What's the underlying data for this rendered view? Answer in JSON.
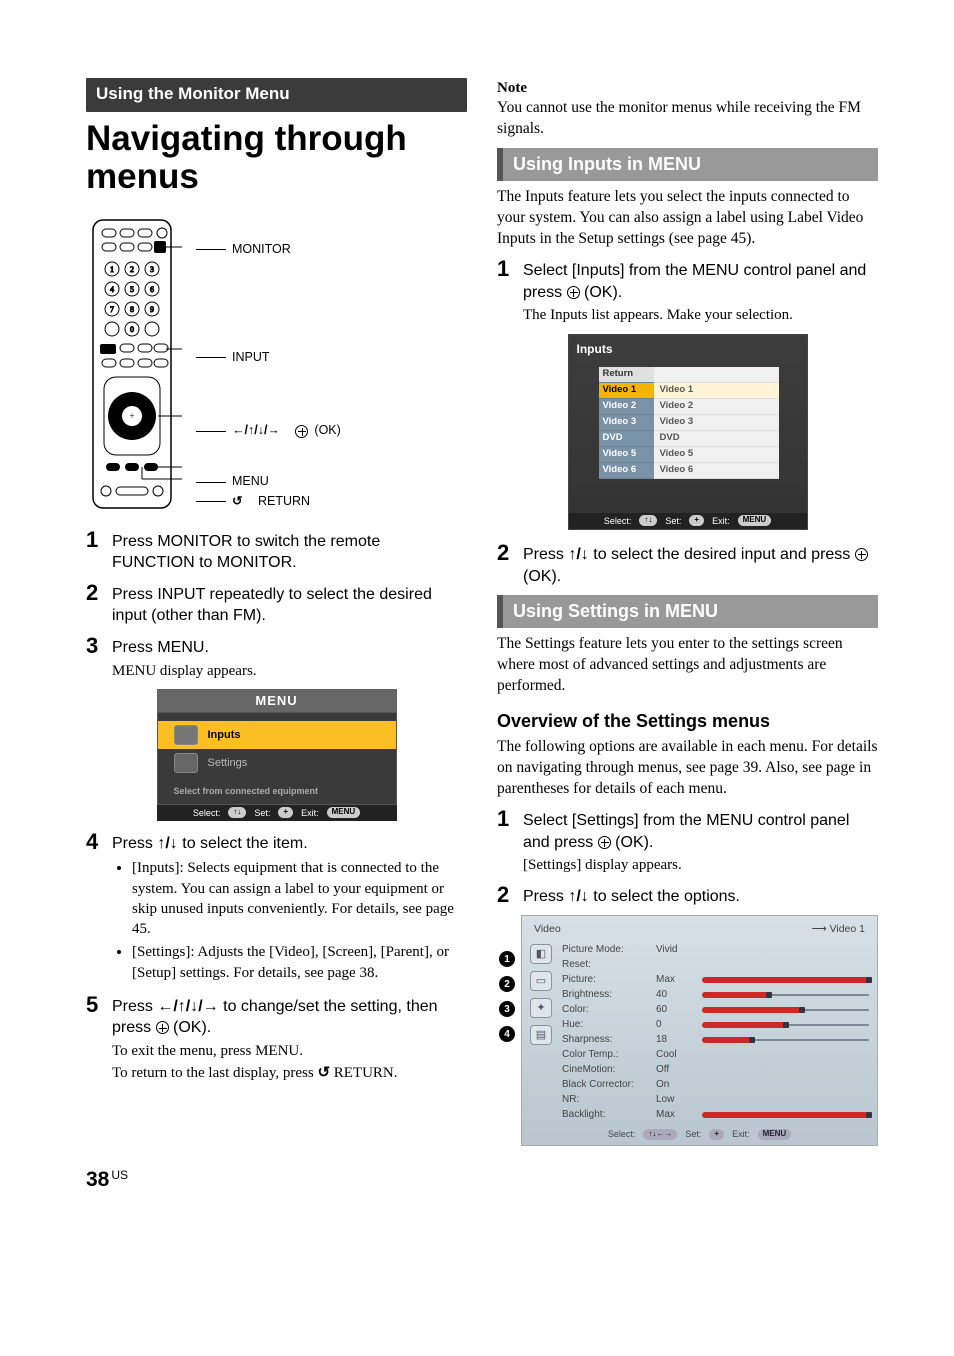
{
  "page": {
    "number": "38",
    "suffix": "US"
  },
  "left": {
    "section_bar": "Using the Monitor Menu",
    "title": "Navigating through menus",
    "remote_labels": {
      "monitor": "MONITOR",
      "input": "INPUT",
      "arrows_ok": "B/V/v/b     (OK)",
      "menu": "MENU",
      "return": "RETURN"
    },
    "steps": {
      "s1": "Press MONITOR to switch the remote FUNCTION to MONITOR.",
      "s2": "Press INPUT repeatedly to select the desired input (other than FM).",
      "s3": "Press MENU.",
      "s3b": "MENU display appears.",
      "s4": "Press V/v to select the item.",
      "s4_bullets": [
        "[Inputs]: Selects equipment that is connected to the system. You can assign a label to your equipment or skip unused inputs conveniently. For details, see page 45.",
        "[Settings]: Adjusts the [Video], [Screen], [Parent], or [Setup] settings. For details, see page 38."
      ],
      "s5a": "Press B/V/v/b to change/set the setting, then press   (OK).",
      "s5b": "To exit the menu, press MENU.",
      "s5c": "To return to the last display, press O RETURN."
    },
    "menu_screen": {
      "title": "MENU",
      "inputs": "Inputs",
      "settings": "Settings",
      "hint": "Select from connected equipment",
      "footer_select": "Select:",
      "footer_set": "Set:",
      "footer_exit": "Exit:",
      "footer_menu": "MENU"
    }
  },
  "right": {
    "note_h": "Note",
    "note_body": "You cannot use the monitor menus while receiving the FM signals.",
    "inputs_bar": "Using Inputs in MENU",
    "inputs_intro": "The Inputs feature lets you select the inputs connected to your system. You can also assign a label using Label Video Inputs in the Setup settings (see page 45).",
    "inputs_step1a": "Select [Inputs] from the MENU control panel and press   (OK).",
    "inputs_step1b": "The Inputs list appears. Make your selection.",
    "inputs_screen": {
      "hdr": "Inputs",
      "rows": [
        {
          "k": "Return",
          "v": ""
        },
        {
          "k": "Video 1",
          "v": "Video 1"
        },
        {
          "k": "Video 2",
          "v": "Video 2"
        },
        {
          "k": "Video 3",
          "v": "Video 3"
        },
        {
          "k": "DVD",
          "v": "DVD"
        },
        {
          "k": "Video 5",
          "v": "Video 5"
        },
        {
          "k": "Video 6",
          "v": "Video 6"
        }
      ],
      "footer_select": "Select:",
      "footer_set": "Set:",
      "footer_exit": "Exit:",
      "footer_menu": "MENU"
    },
    "inputs_step2": "Press V/v to select the desired input and press   (OK).",
    "settings_bar": "Using Settings in MENU",
    "settings_intro": "The Settings feature lets you enter to the settings screen where most of advanced settings and adjustments are performed.",
    "overview_h": "Overview of the Settings menus",
    "overview_body": "The following options are available in each menu. For details on navigating through menus, see page 39. Also, see page in parentheses for details of each menu.",
    "settings_step1a": "Select [Settings] from the MENU control panel and press   (OK).",
    "settings_step1b": "[Settings] display appears.",
    "settings_step2": "Press V/v to select the options.",
    "video_screen": {
      "tab": "Video",
      "src": "Video 1",
      "rows": [
        {
          "k": "Picture Mode:",
          "v": "Vivid",
          "bar": null,
          "fill": 0
        },
        {
          "k": "Reset:",
          "v": "",
          "bar": null,
          "fill": 0
        },
        {
          "k": "Picture:",
          "v": "Max",
          "bar": true,
          "fill": 100
        },
        {
          "k": "Brightness:",
          "v": "40",
          "bar": true,
          "fill": 40
        },
        {
          "k": "Color:",
          "v": "60",
          "bar": true,
          "fill": 60
        },
        {
          "k": "Hue:",
          "v": "0",
          "bar": true,
          "fill": 50
        },
        {
          "k": "Sharpness:",
          "v": "18",
          "bar": true,
          "fill": 30
        },
        {
          "k": "Color Temp.:",
          "v": "Cool",
          "bar": null,
          "fill": 0
        },
        {
          "k": "CineMotion:",
          "v": "Off",
          "bar": null,
          "fill": 0
        },
        {
          "k": "Black Corrector:",
          "v": "On",
          "bar": null,
          "fill": 0
        },
        {
          "k": "NR:",
          "v": "Low",
          "bar": null,
          "fill": 0
        },
        {
          "k": "Backlight:",
          "v": "Max",
          "bar": true,
          "fill": 100
        }
      ],
      "footer_select": "Select:",
      "footer_set": "Set:",
      "footer_exit": "Exit:",
      "footer_menu": "MENU"
    }
  }
}
